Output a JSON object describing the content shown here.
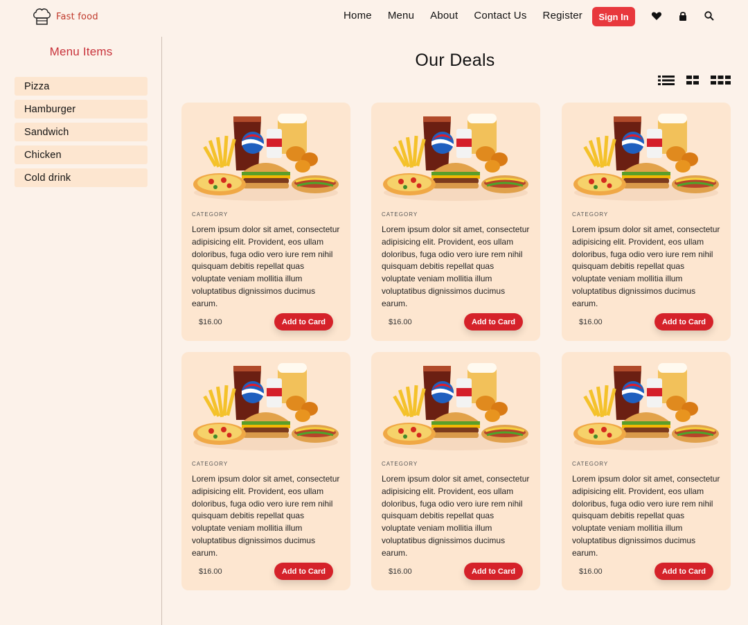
{
  "brand": {
    "name": "Fast food",
    "logo_icon": "chef-hat-icon"
  },
  "nav": {
    "links": [
      "Home",
      "Menu",
      "About",
      "Contact Us",
      "Register"
    ],
    "signin_label": "Sign In",
    "icons": [
      "heart-icon",
      "lock-icon",
      "search-icon"
    ]
  },
  "sidebar": {
    "title": "Menu Items",
    "items": [
      "Pizza",
      "Hamburger",
      "Sandwich",
      "Chicken",
      "Cold drink"
    ]
  },
  "main": {
    "title": "Our Deals",
    "view_options": [
      "list-view-icon",
      "grid-2-icon",
      "grid-3-icon"
    ]
  },
  "cards": [
    {
      "category": "CATEGORY",
      "description": "Lorem ipsum dolor sit amet, consectetur adipisicing elit. Provident, eos ullam doloribus, fuga odio vero iure rem nihil quisquam debitis repellat quas voluptate veniam mollitia illum voluptatibus dignissimos ducimus earum.",
      "price": "$16.00",
      "button": "Add to Card"
    },
    {
      "category": "CATEGORY",
      "description": "Lorem ipsum dolor sit amet, consectetur adipisicing elit. Provident, eos ullam doloribus, fuga odio vero iure rem nihil quisquam debitis repellat quas voluptate veniam mollitia illum voluptatibus dignissimos ducimus earum.",
      "price": "$16.00",
      "button": "Add to Card"
    },
    {
      "category": "CATEGORY",
      "description": "Lorem ipsum dolor sit amet, consectetur adipisicing elit. Provident, eos ullam doloribus, fuga odio vero iure rem nihil quisquam debitis repellat quas voluptate veniam mollitia illum voluptatibus dignissimos ducimus earum.",
      "price": "$16.00",
      "button": "Add to Card"
    },
    {
      "category": "CATEGORY",
      "description": "Lorem ipsum dolor sit amet, consectetur adipisicing elit. Provident, eos ullam doloribus, fuga odio vero iure rem nihil quisquam debitis repellat quas voluptate veniam mollitia illum voluptatibus dignissimos ducimus earum.",
      "price": "$16.00",
      "button": "Add to Card"
    },
    {
      "category": "CATEGORY",
      "description": "Lorem ipsum dolor sit amet, consectetur adipisicing elit. Provident, eos ullam doloribus, fuga odio vero iure rem nihil quisquam debitis repellat quas voluptate veniam mollitia illum voluptatibus dignissimos ducimus earum.",
      "price": "$16.00",
      "button": "Add to Card"
    },
    {
      "category": "CATEGORY",
      "description": "Lorem ipsum dolor sit amet, consectetur adipisicing elit. Provident, eos ullam doloribus, fuga odio vero iure rem nihil quisquam debitis repellat quas voluptate veniam mollitia illum voluptatibus dignissimos ducimus earum.",
      "price": "$16.00",
      "button": "Add to Card"
    }
  ],
  "colors": {
    "page_bg": "#fcf2ea",
    "card_bg": "#fde6d0",
    "accent": "#d5222a",
    "brand": "#c0392b"
  }
}
